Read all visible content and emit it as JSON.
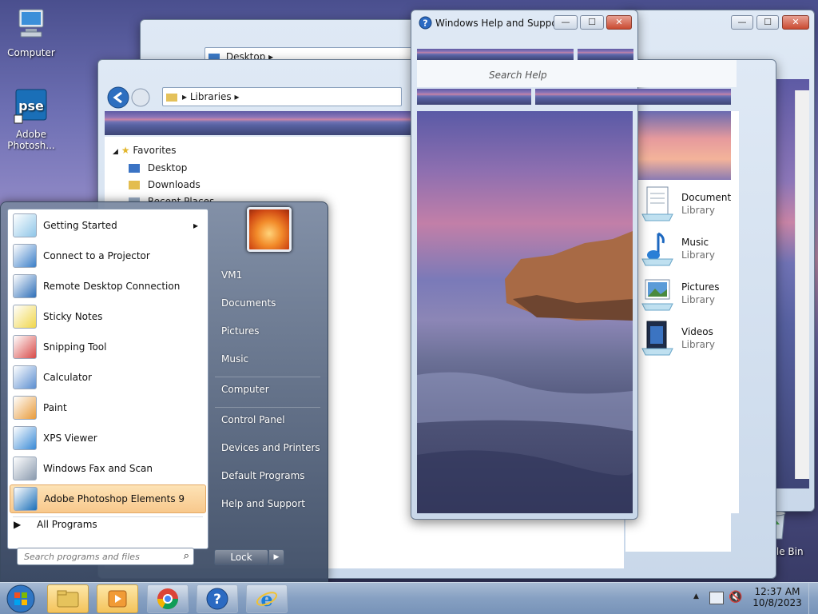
{
  "desktop": {
    "icons": [
      {
        "label": "Computer",
        "icon": "computer-icon"
      },
      {
        "label": "Adobe Photosh...",
        "icon": "photoshop-elements-icon"
      },
      {
        "label": "Recycle Bin",
        "icon": "recycle-bin-icon"
      }
    ]
  },
  "explorer_back": {
    "address": "Desktop"
  },
  "explorer_front": {
    "address": "Libraries",
    "nav": {
      "favorites": "Favorites",
      "items": [
        "Desktop",
        "Downloads",
        "Recent Places"
      ]
    }
  },
  "libraries": [
    {
      "name": "Documents",
      "sub": "Library",
      "icon": "documents-library-icon"
    },
    {
      "name": "Music",
      "sub": "Library",
      "icon": "music-library-icon"
    },
    {
      "name": "Pictures",
      "sub": "Library",
      "icon": "pictures-library-icon"
    },
    {
      "name": "Videos",
      "sub": "Library",
      "icon": "videos-library-icon"
    }
  ],
  "help_window": {
    "title": "Windows Help and Support",
    "search_placeholder": "Search Help",
    "buttons": {
      "minimize": "—",
      "maximize": "☐",
      "close": "✕"
    }
  },
  "start_menu": {
    "programs": [
      {
        "label": "Getting Started",
        "icon": "getting-started-icon",
        "submenu": true
      },
      {
        "label": "Connect to a Projector",
        "icon": "projector-icon"
      },
      {
        "label": "Remote Desktop Connection",
        "icon": "remote-desktop-icon"
      },
      {
        "label": "Sticky Notes",
        "icon": "sticky-notes-icon"
      },
      {
        "label": "Snipping Tool",
        "icon": "snipping-tool-icon"
      },
      {
        "label": "Calculator",
        "icon": "calculator-icon"
      },
      {
        "label": "Paint",
        "icon": "paint-icon"
      },
      {
        "label": "XPS Viewer",
        "icon": "xps-viewer-icon"
      },
      {
        "label": "Windows Fax and Scan",
        "icon": "fax-scan-icon"
      },
      {
        "label": "Adobe Photoshop Elements 9",
        "icon": "photoshop-elements-icon",
        "highlighted": true
      }
    ],
    "all_programs": "All Programs",
    "search_placeholder": "Search programs and files",
    "right_items": [
      "VM1",
      "Documents",
      "Pictures",
      "Music",
      "Computer",
      "Control Panel",
      "Devices and Printers",
      "Default Programs",
      "Help and Support"
    ],
    "lock_label": "Lock"
  },
  "taskbar": {
    "buttons": [
      "start-orb",
      "explorer",
      "media-player",
      "chrome",
      "help",
      "internet-explorer"
    ],
    "clock_time": "12:37 AM",
    "clock_date": "10/8/2023"
  },
  "colors": {
    "accent": "#f8c88c",
    "taskbar": "#86a0c2",
    "close": "#c94a31"
  }
}
